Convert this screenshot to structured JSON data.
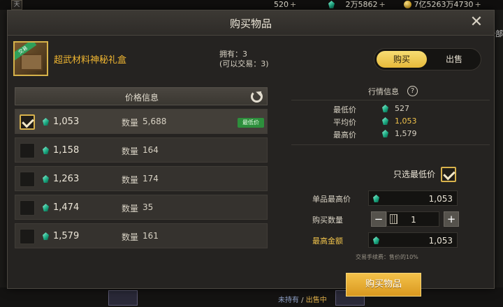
{
  "hud": {
    "left_icon": "天",
    "stat1": "520",
    "stat2": "2万5862",
    "stat3": "7亿5263万4730",
    "plus": "+",
    "edge_text": "全部"
  },
  "dialog": {
    "title": "购买物品",
    "close_label": "✕"
  },
  "item": {
    "name": "超武材料神秘礼盒",
    "icon_tag": "交易",
    "owned_line": "拥有：3",
    "tradable_line": "(可以交易：3)"
  },
  "mode_toggle": {
    "buy": "购买",
    "sell": "出售",
    "active": "buy"
  },
  "price_list": {
    "title": "价格信息",
    "qty_label": "数量",
    "lowest_badge": "最低价",
    "rows": [
      {
        "price": "1,053",
        "qty": "5,688",
        "selected": true,
        "lowest": true
      },
      {
        "price": "1,158",
        "qty": "164",
        "selected": false,
        "lowest": false
      },
      {
        "price": "1,263",
        "qty": "174",
        "selected": false,
        "lowest": false
      },
      {
        "price": "1,474",
        "qty": "35",
        "selected": false,
        "lowest": false
      },
      {
        "price": "1,579",
        "qty": "161",
        "selected": false,
        "lowest": false
      }
    ]
  },
  "market": {
    "title": "行情信息",
    "help": "?",
    "min_label": "最低价",
    "min_value": "527",
    "avg_label": "平均价",
    "avg_value": "1,053",
    "max_label": "最高价",
    "max_value": "1,579"
  },
  "form": {
    "only_lowest_label": "只选最低价",
    "only_lowest_checked": true,
    "unit_max_label": "单品最高价",
    "unit_max_value": "1,053",
    "qty_label": "购买数量",
    "qty_value": "1",
    "minus": "−",
    "plus": "+",
    "max_total_label": "最高金额",
    "max_total_value": "1,053",
    "fee_note": "交易手续费：售价的10%"
  },
  "buy_button": "购买物品",
  "bottom": {
    "unheld": "未持有",
    "separator": " / ",
    "selling": "出售中"
  },
  "colors": {
    "accent_gold": "#f1c34b",
    "lowest_badge": "#2d8f3c",
    "panel_bg": "#252321"
  }
}
